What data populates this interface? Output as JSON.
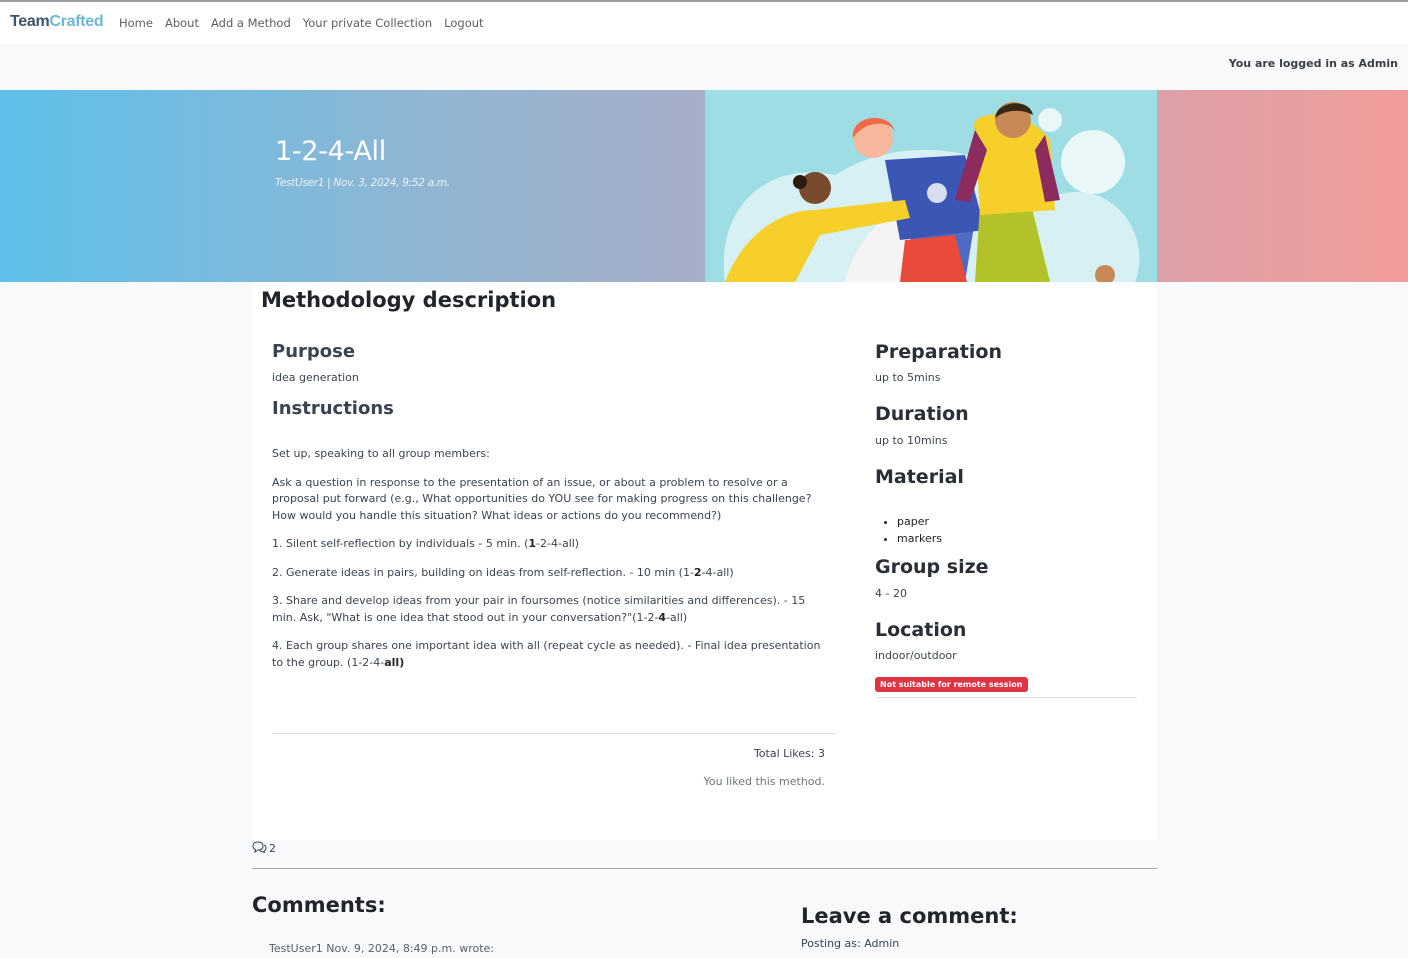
{
  "nav": {
    "brand_part1": "Team",
    "brand_part2": "Crafted",
    "links": [
      "Home",
      "About",
      "Add a Method",
      "Your private Collection",
      "Logout"
    ]
  },
  "login_status": "You are logged in as Admin",
  "hero": {
    "title": "1-2-4-All",
    "meta": "TestUser1 | Nov. 3, 2024, 9:52 a.m."
  },
  "description": {
    "heading": "Methodology description",
    "purpose_label": "Purpose",
    "purpose_value": "idea generation",
    "instructions_label": "Instructions",
    "instructions": {
      "p1": "Set up, speaking to all group members:",
      "p2": "Ask a question in response to the presentation of an issue, or about a problem to resolve or a proposal put forward (e.g., What opportunities do YOU see for making progress on this challenge? How would you handle this situation? What ideas or actions do you recommend?)",
      "p3_text": "1. Silent self-reflection by individuals - 5 min. (",
      "p3_bold": "1",
      "p3_end": "-2-4-all)",
      "p4_text": "2. Generate ideas in pairs, building on ideas from self-reflection. - 10 min (1-",
      "p4_bold": "2",
      "p4_end": "-4-all)",
      "p5_text": "3. Share and develop ideas from your pair in foursomes (notice similarities and differences). - 15 min. Ask, \"What is one idea that stood out in your conversation?\"(1-2-",
      "p5_bold": "4",
      "p5_end": "-all)",
      "p6_text": "4. Each group shares one important idea with all (repeat cycle as needed). - Final idea presentation to the group. (1-2-4-",
      "p6_bold": "all)"
    },
    "total_likes": "Total Likes: 3",
    "liked_msg": "You liked this method."
  },
  "sidebar": {
    "preparation_label": "Preparation",
    "preparation_value": "up to 5mins",
    "duration_label": "Duration",
    "duration_value": "up to 10mins",
    "material_label": "Material",
    "materials": [
      "paper",
      "markers"
    ],
    "group_size_label": "Group size",
    "group_size_value": "4 - 20",
    "location_label": "Location",
    "location_value": "indoor/outdoor",
    "remote_badge": "Not suitable for remote session"
  },
  "comments": {
    "count": "2",
    "heading": "Comments:",
    "first_meta": "TestUser1 Nov. 9, 2024, 8:49 p.m. wrote:",
    "leave_heading": "Leave a comment:",
    "posting_as": "Posting as: Admin"
  },
  "colors": {
    "brand_dark": "#3e5366",
    "brand_light": "#6fb6d8",
    "badge_red": "#dc3545",
    "hero_left": "#5ec0ea",
    "hero_right": "#f19c9a"
  }
}
